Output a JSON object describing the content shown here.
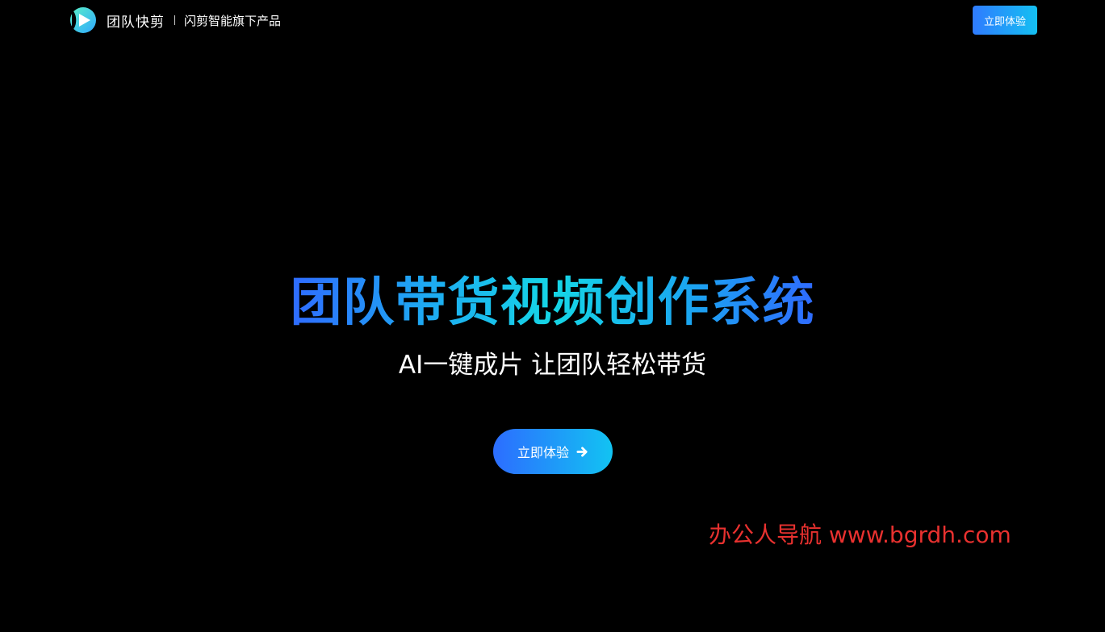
{
  "header": {
    "brand_name": "团队快剪",
    "tagline": "闪剪智能旗下产品",
    "cta_label": "立即体验",
    "logo_icon": "play-logo-icon"
  },
  "hero": {
    "title": "团队带货视频创作系统",
    "subtitle": "AI一键成片 让团队轻松带货",
    "cta_label": "立即体验",
    "cta_icon": "arrow-right-icon"
  },
  "watermark": {
    "text": "办公人导航 www.bgrdh.com"
  },
  "colors": {
    "background": "#000000",
    "accent_start": "#2f6bff",
    "accent_end": "#14c0f2",
    "watermark": "#e8312f"
  }
}
